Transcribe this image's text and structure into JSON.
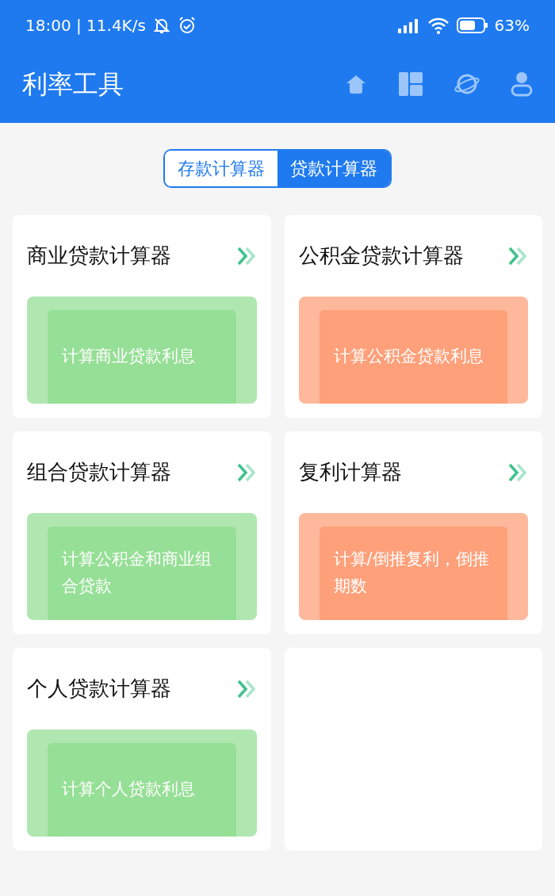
{
  "status_bar": {
    "time": "18:00 | 11.4K/s",
    "battery": "63%"
  },
  "header": {
    "title": "利率工具"
  },
  "tabs": [
    {
      "label": "存款计算器",
      "selected": false
    },
    {
      "label": "贷款计算器",
      "selected": true
    }
  ],
  "cards": [
    {
      "title": "商业贷款计算器",
      "description": "计算商业贷款利息",
      "color": "#96df96"
    },
    {
      "title": "公积金贷款计算器",
      "description": "计算公积金贷款利息",
      "color": "#fea07a"
    },
    {
      "title": "组合贷款计算器",
      "description": "计算公积金和商业组合贷款",
      "color": "#96df96"
    },
    {
      "title": "复利计算器",
      "description": "计算/倒推复利，倒推期数",
      "color": "#fea07a"
    },
    {
      "title": "个人贷款计算器",
      "description": "计算个人贷款利息",
      "color": "#96df96"
    }
  ]
}
